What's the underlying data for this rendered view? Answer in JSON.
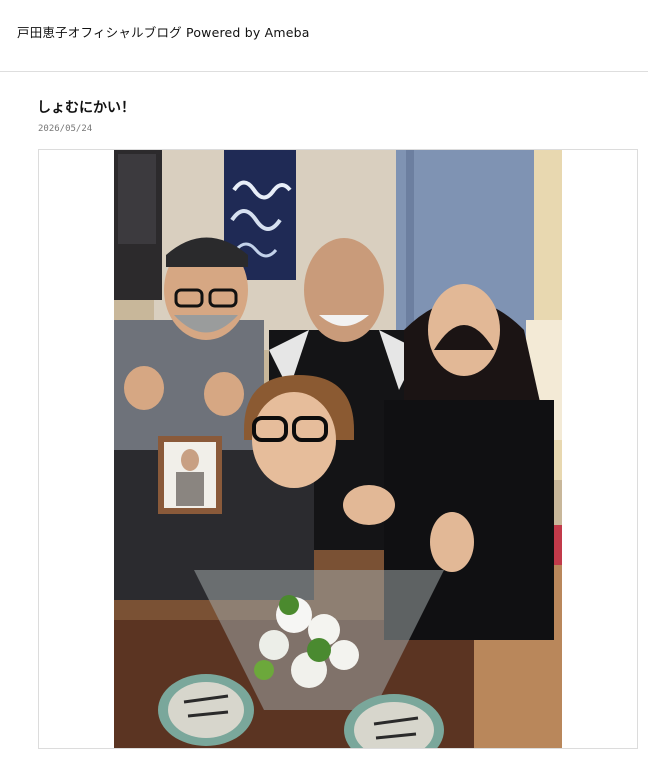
{
  "header": {
    "blog_title": "戸田恵子オフィシャルブログ Powered by Ameba"
  },
  "entry": {
    "title": "しょむにかい！",
    "date": "2026/05/24"
  },
  "photo": {
    "framed_portrait": true,
    "bouquet": true
  }
}
